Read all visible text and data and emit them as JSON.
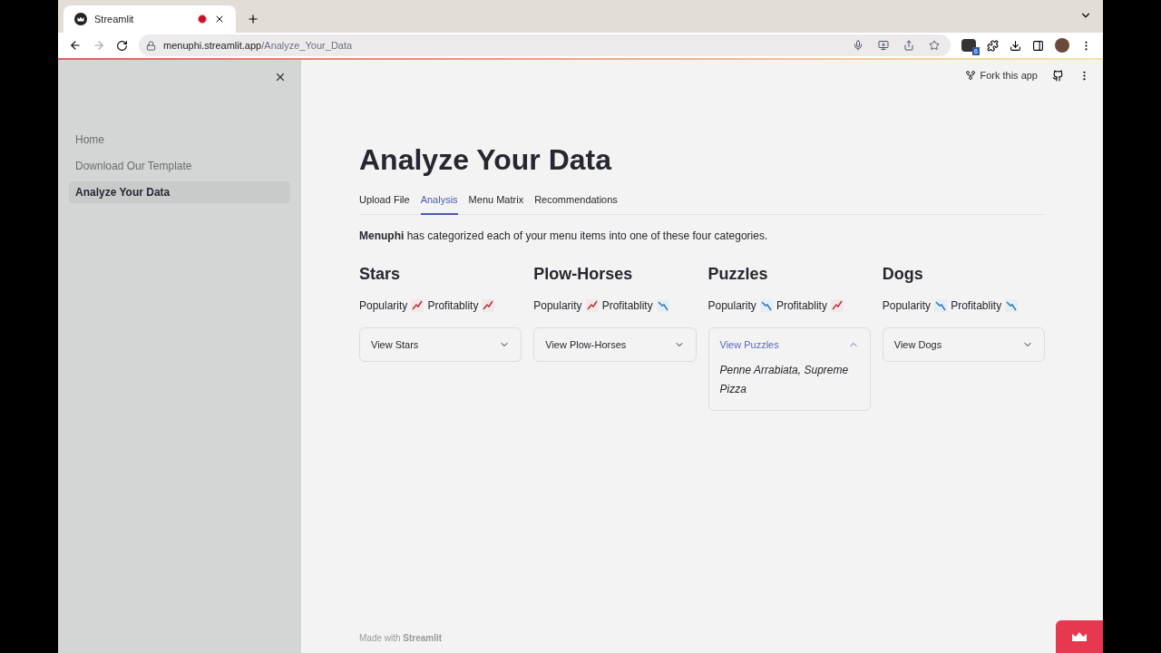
{
  "browser": {
    "tab": {
      "title": "Streamlit",
      "recording": true
    },
    "url_host": "menuphi.streamlit.app",
    "url_path": "/Analyze_Your_Data",
    "extension_badge": "6"
  },
  "sidebar": {
    "items": [
      {
        "label": "Home",
        "selected": false
      },
      {
        "label": "Download Our Template",
        "selected": false
      },
      {
        "label": "Analyze Your Data",
        "selected": true
      }
    ]
  },
  "header": {
    "fork_label": "Fork this app"
  },
  "page": {
    "title": "Analyze Your Data",
    "tabs": [
      {
        "label": "Upload File",
        "selected": false
      },
      {
        "label": "Analysis",
        "selected": true
      },
      {
        "label": "Menu Matrix",
        "selected": false
      },
      {
        "label": "Recommendations",
        "selected": false
      }
    ],
    "intro": "**Menuphi** has categorized each of your menu items into one of these four categories.",
    "categories": [
      {
        "title": "Stars",
        "popularity_label": "Popularity",
        "popularity_rising": true,
        "profitability_label": "Profitablity",
        "profitability_rising": true,
        "expander": "View Stars",
        "expanded": false
      },
      {
        "title": "Plow-Horses",
        "popularity_label": "Popularity",
        "popularity_rising": true,
        "profitability_label": "Profitablity",
        "profitability_rising": false,
        "expander": "View Plow-Horses",
        "expanded": false
      },
      {
        "title": "Puzzles",
        "popularity_label": "Popularity",
        "popularity_rising": false,
        "profitability_label": "Profitablity",
        "profitability_rising": true,
        "expander": "View Puzzles",
        "expanded": true,
        "content": "Penne Arrabiata, Supreme Pizza"
      },
      {
        "title": "Dogs",
        "popularity_label": "Popularity",
        "popularity_rising": false,
        "profitability_label": "Profitablity",
        "profitability_rising": false,
        "expander": "View Dogs",
        "expanded": false
      }
    ]
  },
  "footer": "Made with **Streamlit**"
}
